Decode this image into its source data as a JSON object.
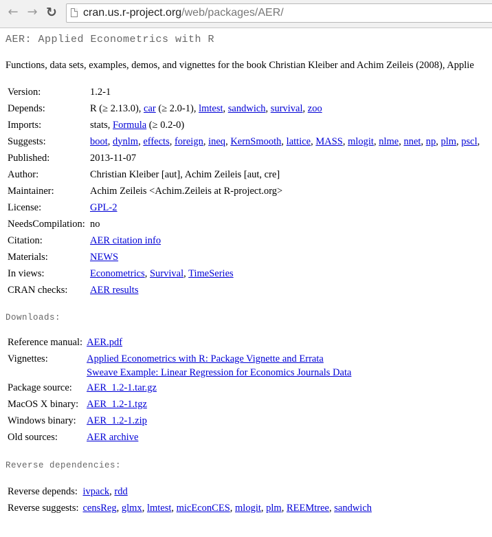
{
  "browser": {
    "url_host": "cran.us.r-project.org",
    "url_path": "/web/packages/AER/"
  },
  "page": {
    "title": "AER: Applied Econometrics with R",
    "description": "Functions, data sets, examples, demos, and vignettes for the book Christian Kleiber and Achim Zeileis (2008), Applie"
  },
  "info": {
    "version_label": "Version:",
    "version": "1.2-1",
    "depends_label": "Depends:",
    "depends_prefix": "R (≥ 2.13.0),",
    "depends_car": "car",
    "depends_car_ver": "(≥ 2.0-1),",
    "depends_links": [
      "lmtest",
      "sandwich",
      "survival",
      "zoo"
    ],
    "imports_label": "Imports:",
    "imports_prefix": "stats,",
    "imports_formula": "Formula",
    "imports_suffix": "(≥ 0.2-0)",
    "suggests_label": "Suggests:",
    "suggests": [
      "boot",
      "dynlm",
      "effects",
      "foreign",
      "ineq",
      "KernSmooth",
      "lattice",
      "MASS",
      "mlogit",
      "nlme",
      "nnet",
      "np",
      "plm",
      "pscl"
    ],
    "published_label": "Published:",
    "published": "2013-11-07",
    "author_label": "Author:",
    "author": "Christian Kleiber [aut], Achim Zeileis [aut, cre]",
    "maintainer_label": "Maintainer:",
    "maintainer": "Achim Zeileis <Achim.Zeileis at R-project.org>",
    "license_label": "License:",
    "license": "GPL-2",
    "needscomp_label": "NeedsCompilation:",
    "needscomp": "no",
    "citation_label": "Citation:",
    "citation": "AER citation info",
    "materials_label": "Materials:",
    "materials": "NEWS",
    "inviews_label": "In views:",
    "inviews": [
      "Econometrics",
      "Survival",
      "TimeSeries"
    ],
    "cranchecks_label": "CRAN checks:",
    "cranchecks": "AER results"
  },
  "downloads": {
    "heading": "Downloads:",
    "refman_label": "Reference manual:",
    "refman": "AER.pdf",
    "vignettes_label": "Vignettes:",
    "vignette1": "Applied Econometrics with R: Package Vignette and Errata",
    "vignette2": "Sweave Example: Linear Regression for Economics Journals Data",
    "source_label": "Package source:",
    "source": "AER_1.2-1.tar.gz",
    "macos_label": "MacOS X binary:",
    "macos": "AER_1.2-1.tgz",
    "windows_label": "Windows binary:",
    "windows": "AER_1.2-1.zip",
    "old_label": "Old sources:",
    "old": "AER archive"
  },
  "reverse": {
    "heading": "Reverse dependencies:",
    "depends_label": "Reverse depends:",
    "depends": [
      "ivpack",
      "rdd"
    ],
    "suggests_label": "Reverse suggests:",
    "suggests": [
      "censReg",
      "glmx",
      "lmtest",
      "micEconCES",
      "mlogit",
      "plm",
      "REEMtree",
      "sandwich"
    ]
  },
  "icons": {
    "back": "back-arrow-icon",
    "forward": "forward-arrow-icon",
    "reload": "reload-icon",
    "page": "page-icon"
  }
}
